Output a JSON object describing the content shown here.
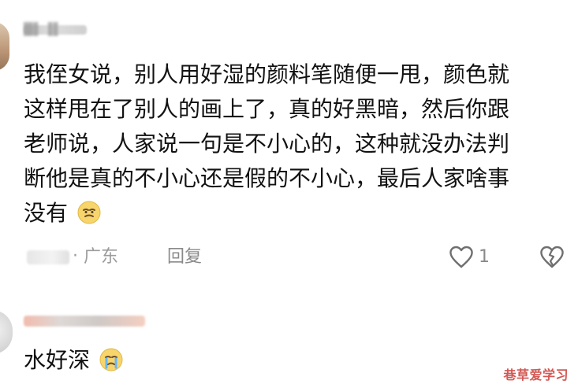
{
  "comments": [
    {
      "username": "█▌▐▌",
      "lines": [
        "我侄女说，别人用好湿的颜料笔随便一甩，颜色就",
        "这样甩在了别人的画上了，真的好黑暗，然后你跟",
        "老师说，人家说一句是不小心的，这种就没办法判",
        "断他是真的不小心还是假的不小心，最后人家啥事",
        "没有"
      ],
      "emoji": "smirk-emoji",
      "meta": {
        "location": "广东",
        "reply_label": "回复",
        "likes": "1"
      }
    },
    {
      "text": "水好深",
      "emoji": "crying-emoji"
    }
  ],
  "ui": {
    "dot": "·"
  },
  "watermark": "巷草爱学习",
  "colors": {
    "text": "#121212",
    "meta": "#9c9c9c",
    "watermark": "#d04a45"
  },
  "icons": {
    "like": "heart-outline-icon",
    "dislike": "broken-heart-icon"
  }
}
